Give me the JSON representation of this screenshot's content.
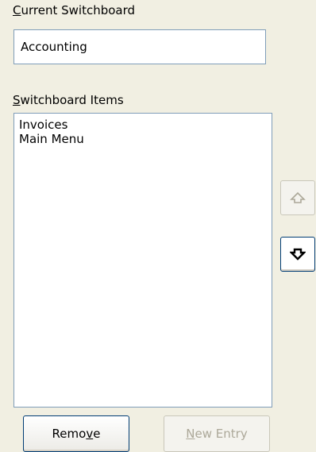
{
  "current_switchboard": {
    "label_hotkey": "C",
    "label_rest": "urrent Switchboard",
    "value": "Accounting"
  },
  "switchboard_items": {
    "label_hotkey": "S",
    "label_rest": "witchboard Items",
    "items": [
      "Invoices",
      "Main Menu"
    ]
  },
  "move_buttons": {
    "up_icon": "up-arrow-icon",
    "down_icon": "down-arrow-icon",
    "up_enabled": false,
    "down_enabled": true
  },
  "buttons": {
    "remove_prefix": "Remo",
    "remove_hotkey": "v",
    "remove_suffix": "e",
    "new_entry_hotkey": "N",
    "new_entry_rest": "ew Entry",
    "new_entry_enabled": false
  }
}
